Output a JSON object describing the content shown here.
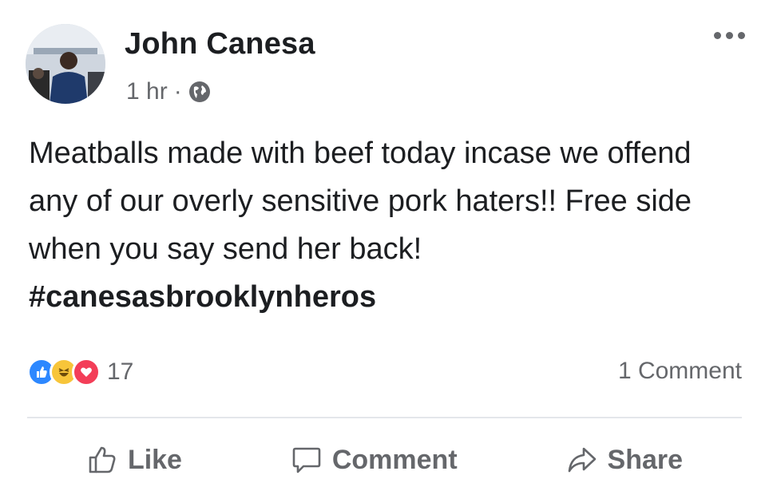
{
  "post": {
    "author": "John Canesa",
    "time": "1 hr",
    "separator": "·",
    "privacy_icon": "globe-icon",
    "more_icon": "more-options-icon",
    "body": {
      "text": "Meatballs made with beef today incase we offend any of our overly sensitive pork haters!! Free side when you say send her back!",
      "hashtag": "#canesasbrooklynheros"
    }
  },
  "engagement": {
    "reaction_icons": [
      "like-reaction-icon",
      "haha-reaction-icon",
      "love-reaction-icon"
    ],
    "reaction_count": "17",
    "comment_count": "1 Comment"
  },
  "actions": {
    "like": "Like",
    "comment": "Comment",
    "share": "Share"
  },
  "colors": {
    "text": "#1c1e21",
    "muted": "#65676b",
    "like": "#2d88ff",
    "haha": "#f7c53a",
    "love": "#f33e58"
  }
}
